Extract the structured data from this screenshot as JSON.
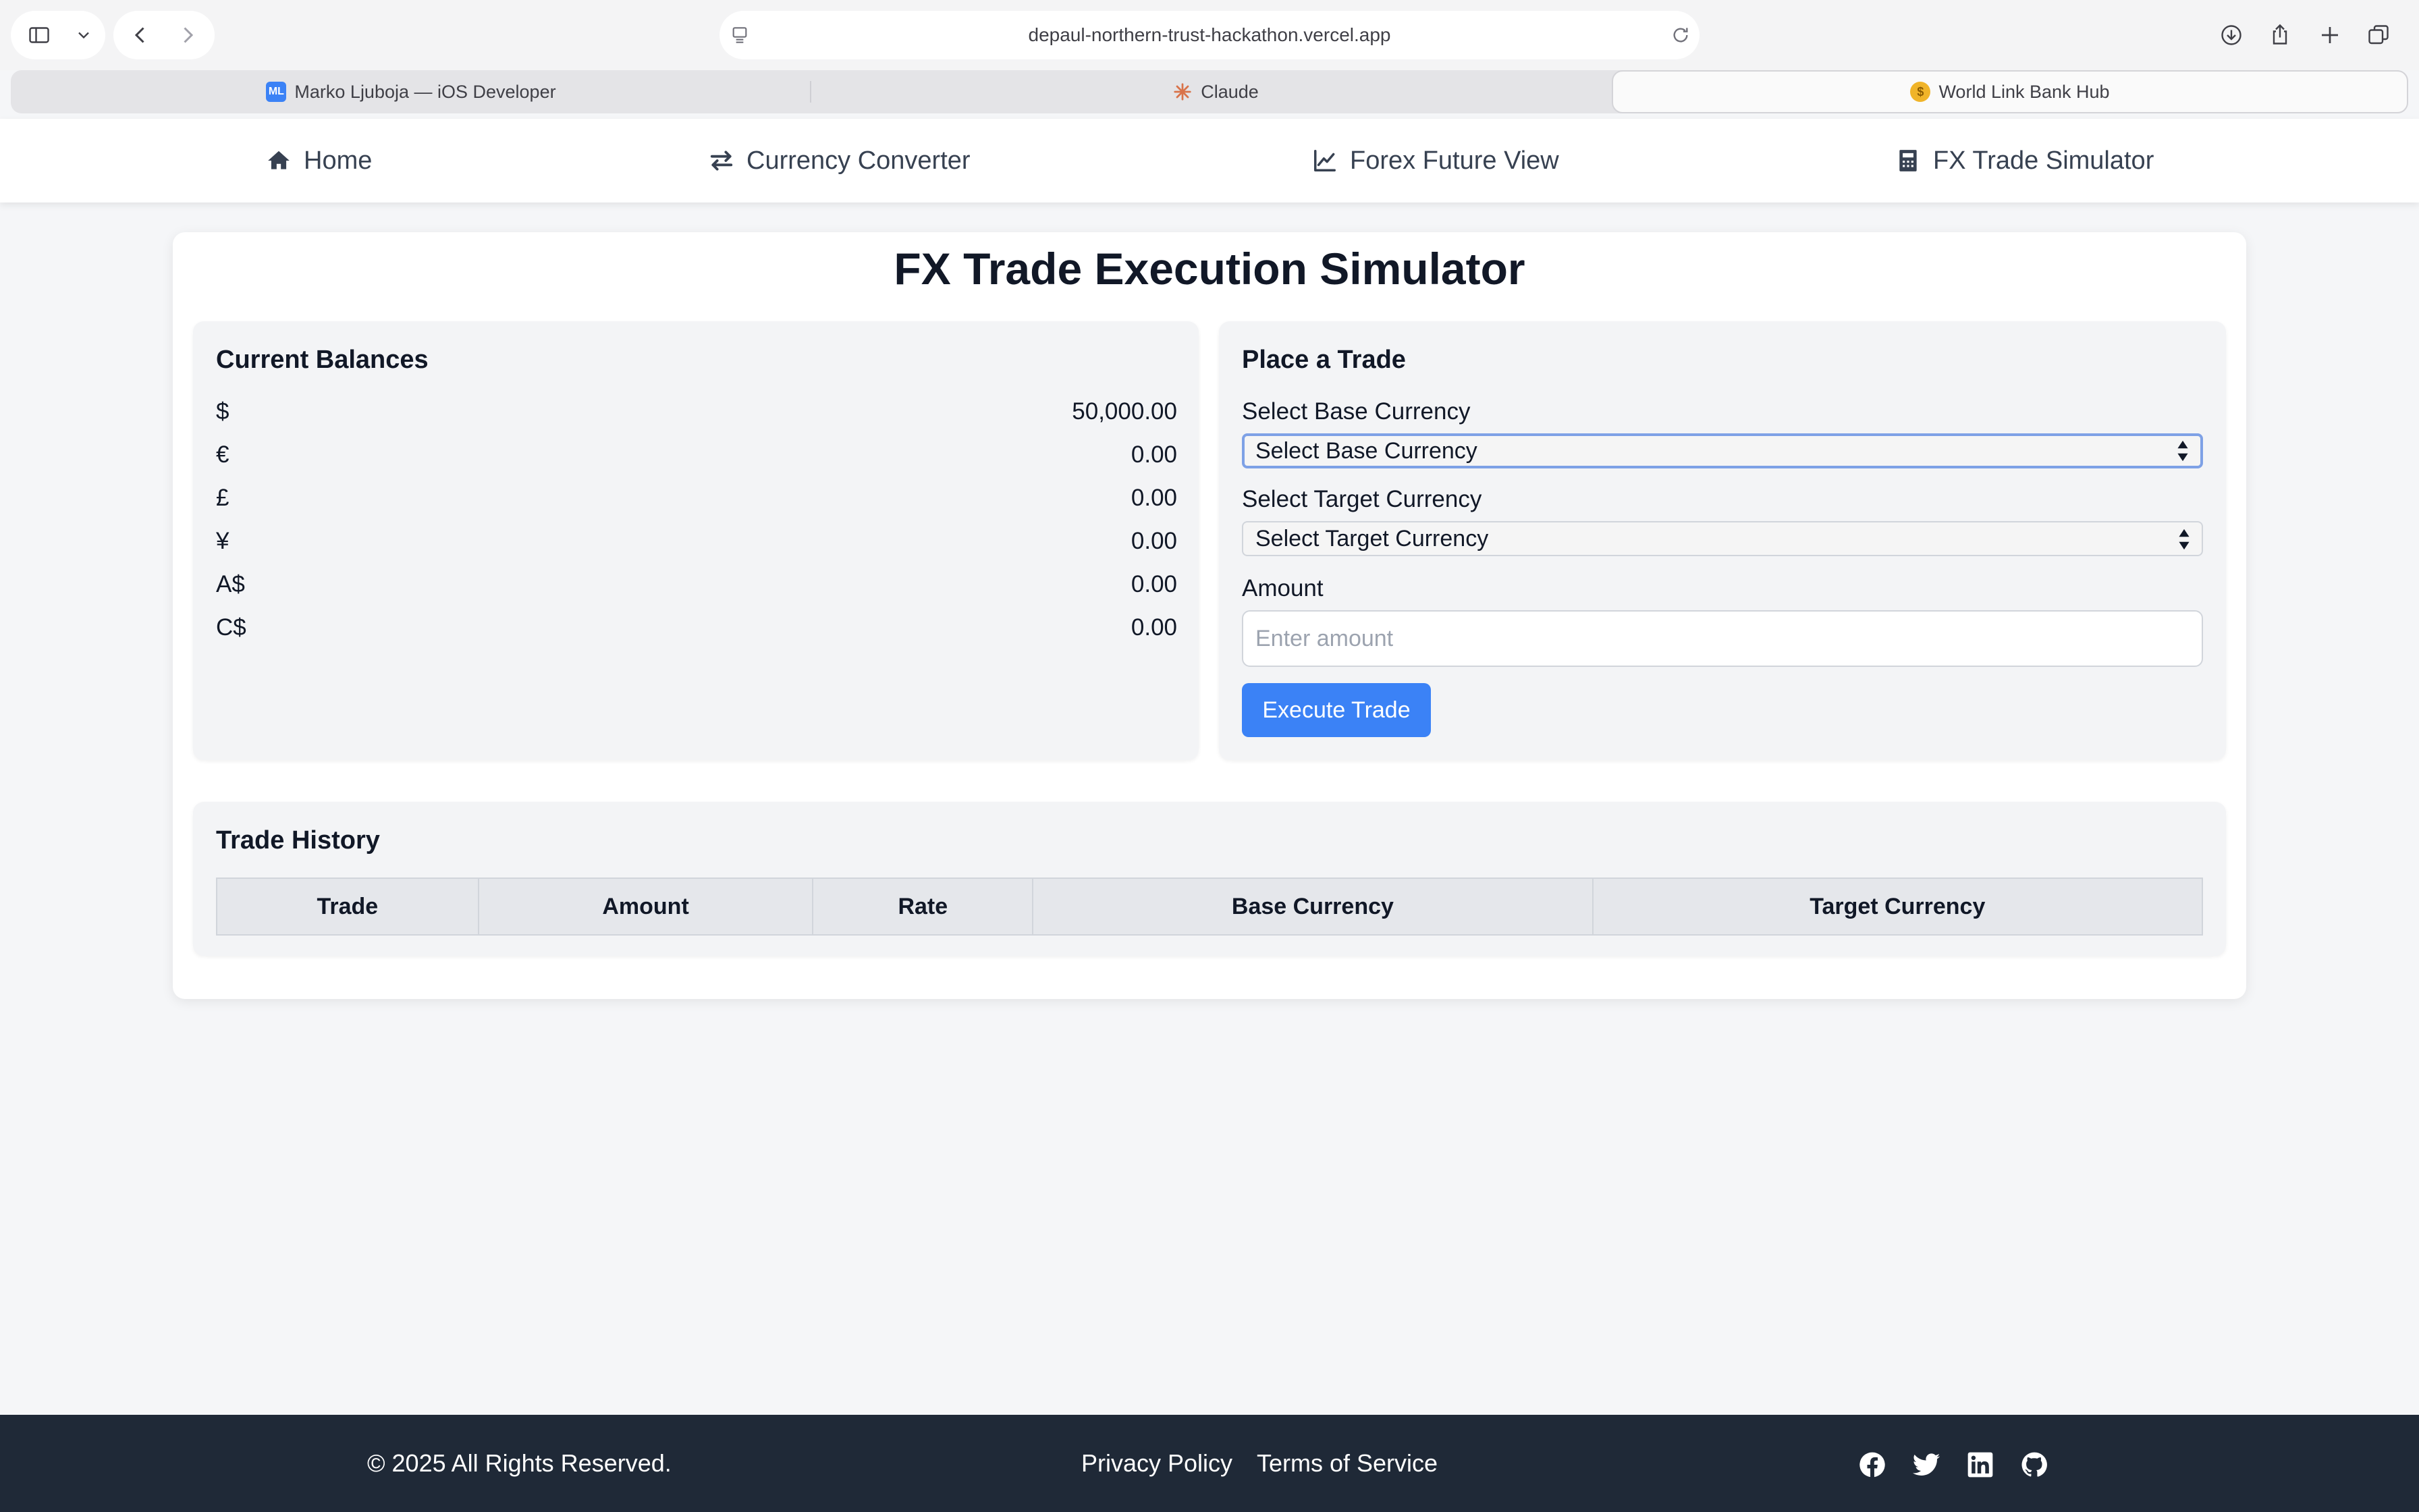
{
  "browser": {
    "url": "depaul-northern-trust-hackathon.vercel.app",
    "tabs": [
      {
        "label": "Marko Ljuboja — iOS Developer",
        "favicon": "ML"
      },
      {
        "label": "Claude"
      },
      {
        "label": "World Link Bank Hub"
      }
    ]
  },
  "nav": {
    "items": [
      {
        "label": "Home"
      },
      {
        "label": "Currency Converter"
      },
      {
        "label": "Forex Future View"
      },
      {
        "label": "FX Trade Simulator"
      }
    ]
  },
  "page": {
    "title": "FX Trade Execution Simulator"
  },
  "balances": {
    "title": "Current Balances",
    "rows": [
      {
        "symbol": "$",
        "value": "50,000.00"
      },
      {
        "symbol": "€",
        "value": "0.00"
      },
      {
        "symbol": "£",
        "value": "0.00"
      },
      {
        "symbol": "¥",
        "value": "0.00"
      },
      {
        "symbol": "A$",
        "value": "0.00"
      },
      {
        "symbol": "C$",
        "value": "0.00"
      }
    ]
  },
  "trade": {
    "title": "Place a Trade",
    "base_label": "Select Base Currency",
    "base_selected": "Select Base Currency",
    "target_label": "Select Target Currency",
    "target_selected": "Select Target Currency",
    "amount_label": "Amount",
    "amount_placeholder": "Enter amount",
    "amount_value": "",
    "execute_label": "Execute Trade"
  },
  "history": {
    "title": "Trade History",
    "columns": [
      "Trade",
      "Amount",
      "Rate",
      "Base Currency",
      "Target Currency"
    ],
    "rows": []
  },
  "footer": {
    "copyright": "© 2025 All Rights Reserved.",
    "links": [
      "Privacy Policy",
      "Terms of Service"
    ]
  },
  "colors": {
    "accent": "#3b82f6",
    "footer_bg": "#1f2937",
    "panel_bg": "#f3f4f6"
  }
}
